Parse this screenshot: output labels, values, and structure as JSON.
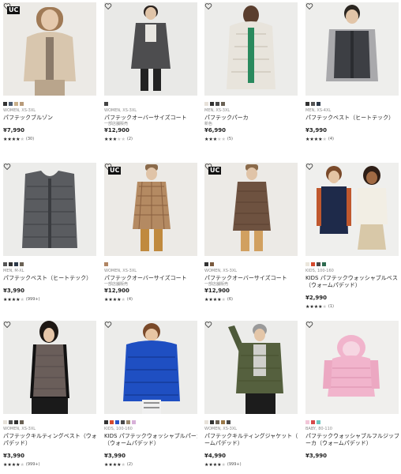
{
  "colors": {
    "background": "#ffffff",
    "price": "#222222",
    "star_on": "#222222",
    "star_off": "#c8c8c8"
  },
  "products": [
    {
      "brand": "UC",
      "swatches": [
        "#333333",
        "#4a5a6e",
        "#c9b08a",
        "#b89b7a"
      ],
      "meta": "WOMEN, XS-3XL",
      "name": "パフテックブルゾン",
      "name2": "",
      "sub": "",
      "price": "¥7,990",
      "stars": "★★★★",
      "stars_off": "★",
      "count": "(30)",
      "icon": "heart-outline-icon"
    },
    {
      "brand": "",
      "swatches": [
        "#444444"
      ],
      "meta": "WOMEN, XS-3XL",
      "name": "パフテックオーバーサイズコート",
      "name2": "",
      "sub": "一部店舗販売",
      "price": "¥12,900",
      "stars": "★★★",
      "stars_off": "★★",
      "count": "(2)",
      "icon": "heart-outline-icon"
    },
    {
      "brand": "",
      "swatches": [
        "#e6e1d9",
        "#333333",
        "#4a4a4a",
        "#6b6255"
      ],
      "meta": "MEN, XS-3XL",
      "name": "パフテックパーカ",
      "name2": "",
      "sub": "新色",
      "price": "¥6,990",
      "stars": "★★★",
      "stars_off": "★★",
      "count": "(5)",
      "icon": "heart-outline-icon"
    },
    {
      "brand": "",
      "swatches": [
        "#333333",
        "#555555",
        "#2d3a4a"
      ],
      "meta": "MEN, XS-4XL",
      "name": "パフテックベスト（ヒートテック）",
      "name2": "",
      "sub": "",
      "price": "¥3,990",
      "stars": "★★★★",
      "stars_off": "★",
      "count": "(4)",
      "icon": "heart-outline-icon"
    },
    {
      "brand": "",
      "swatches": [
        "#555555",
        "#333333",
        "#2d3a4a",
        "#6b6255"
      ],
      "meta": "MEN, M-XL",
      "name": "パフテックベスト（ヒートテック）",
      "name2": "",
      "sub": "",
      "price": "¥3,990",
      "stars": "★★★★",
      "stars_off": "★",
      "count": "(999+)",
      "icon": "heart-outline-icon"
    },
    {
      "brand": "UC",
      "swatches": [
        "#b08563"
      ],
      "meta": "WOMEN, XS-3XL",
      "name": "パフテックオーバーサイズコート",
      "name2": "",
      "sub": "一部店舗販売",
      "price": "¥12,900",
      "stars": "★★★★",
      "stars_off": "★",
      "count": "(4)",
      "icon": "heart-outline-icon"
    },
    {
      "brand": "UC",
      "swatches": [
        "#333333",
        "#7a5a3e"
      ],
      "meta": "WOMEN, XS-3XL",
      "name": "パフテックオーバーサイズコート",
      "name2": "",
      "sub": "一部店舗販売",
      "price": "¥12,900",
      "stars": "★★★★",
      "stars_off": "★",
      "count": "(6)",
      "icon": "heart-outline-icon"
    },
    {
      "brand": "",
      "swatches": [
        "#ebe6dc",
        "#d64a2e",
        "#4a4a4a",
        "#2d6a4f"
      ],
      "meta": "KIDS, 100-160",
      "name": "KIDS パフテックウォッシャブルベスト",
      "name2": "（ウォームパデッド）",
      "sub": "",
      "price": "¥2,990",
      "stars": "★★★★",
      "stars_off": "★",
      "count": "(1)",
      "icon": "heart-outline-icon"
    },
    {
      "brand": "",
      "swatches": [
        "#e6e1d9",
        "#555555",
        "#333333",
        "#6b6255"
      ],
      "meta": "WOMEN, XS-3XL",
      "name": "パフテックキルティングベスト（ウォーム",
      "name2": "パデッド）",
      "sub": "",
      "price": "¥3,990",
      "stars": "★★★★",
      "stars_off": "★",
      "count": "(999+)",
      "icon": "heart-outline-icon"
    },
    {
      "brand": "",
      "swatches": [
        "#333333",
        "#d64a2e",
        "#2b55c6",
        "#4a4a4a",
        "#9c8a6e",
        "#d7b0d8"
      ],
      "meta": "KIDS, 100-160",
      "name": "KIDS パフテックウォッシャブルパーカ",
      "name2": "（ウォームパデッド）",
      "sub": "",
      "price": "¥3,990",
      "stars": "★★★★",
      "stars_off": "★",
      "count": "(2)",
      "icon": "heart-outline-icon"
    },
    {
      "brand": "",
      "swatches": [
        "#e6e1d9",
        "#333333",
        "#6b6255",
        "#9c7a4a",
        "#4a4a4a"
      ],
      "meta": "WOMEN, XS-3XL",
      "name": "パフテックキルティングジャケット（ウォ",
      "name2": "ームパデッド）",
      "sub": "",
      "price": "¥4,990",
      "stars": "★★★★",
      "stars_off": "★",
      "count": "(999+)",
      "icon": "heart-outline-icon"
    },
    {
      "brand": "",
      "swatches": [
        "#f2c6d8",
        "#d64a4a",
        "#6ec6c0"
      ],
      "meta": "BABY, 80-110",
      "name": "パフテックウォッシャブルフルジップパ",
      "name2": "ーカ（ウォームパデッド）",
      "sub": "",
      "price": "¥3,990",
      "stars": "",
      "stars_off": "",
      "count": "",
      "icon": "heart-outline-icon"
    }
  ]
}
